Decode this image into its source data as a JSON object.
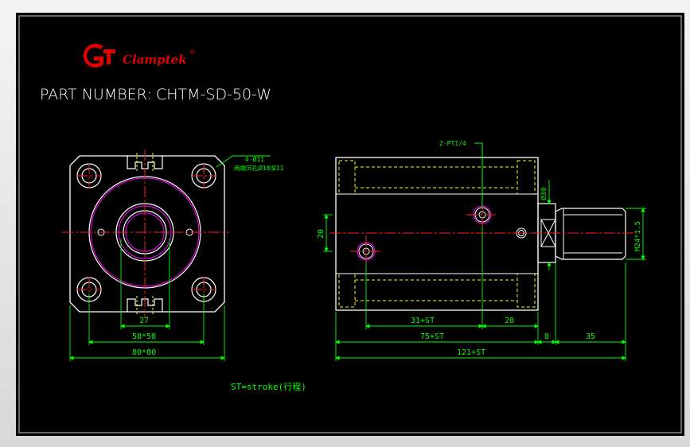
{
  "brand": {
    "logo_text": "Clamptek",
    "registered_mark": "®",
    "logo_color": "#e00000"
  },
  "title": {
    "label": "PART NUMBER:",
    "value": "CHTM-SD-50-W"
  },
  "front_view": {
    "hole_callout_line1": "4-Ø11",
    "hole_callout_line2": "两端沉孔Ø18深11",
    "dim_inner": "27",
    "dim_pitch": "58*58",
    "dim_overall": "80*80"
  },
  "side_view": {
    "port_callout": "2-PT1/4",
    "dim_height": "20",
    "dim_rod_dia": "Ø30",
    "dim_thread": "M24*1.5",
    "dim_port_spacing": "31+ST",
    "dim_port_end": "28",
    "dim_body": "75+ST",
    "dim_total": "121+ST",
    "dim_flange": "8",
    "dim_rod": "35"
  },
  "note": "ST=stroke(行程)",
  "colors": {
    "background": "#000000",
    "outline": "#ffffff",
    "center_line": "#ff2020",
    "dimension": "#00ff00",
    "hidden_line": "#ffff00",
    "magenta": "#ff00ff"
  }
}
